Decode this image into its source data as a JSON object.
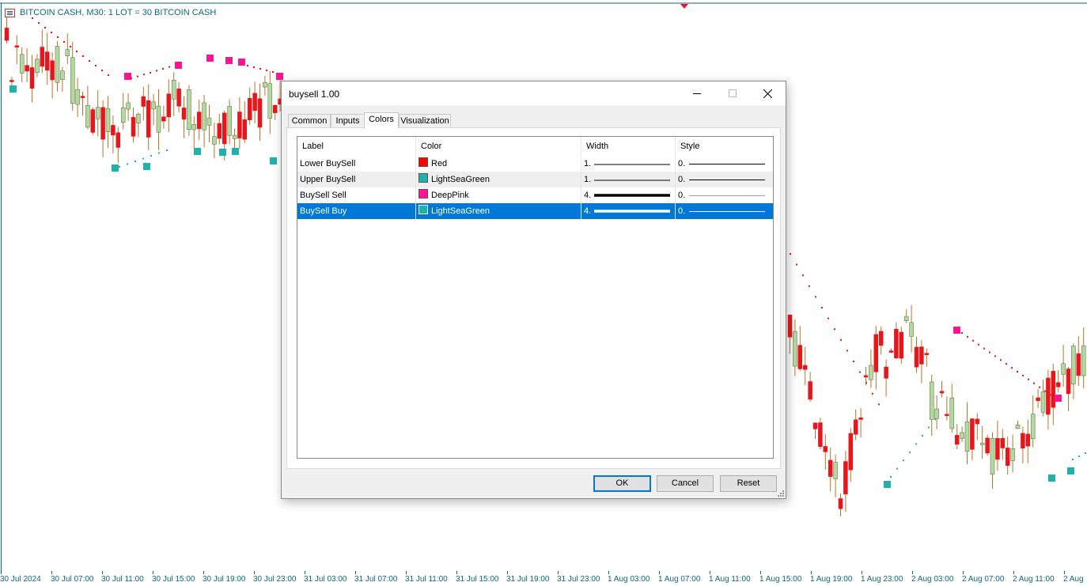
{
  "chart": {
    "header_text": "BITCOIN CASH, M30:  1 LOT = 30 BITCOIN CASH",
    "time_labels": [
      "30 Jul 2024",
      "30 Jul 07:00",
      "30 Jul 11:00",
      "30 Jul 15:00",
      "30 Jul 19:00",
      "30 Jul 23:00",
      "31 Jul 03:00",
      "31 Jul 07:00",
      "31 Jul 11:00",
      "31 Jul 15:00",
      "31 Jul 19:00",
      "31 Jul 23:00",
      "1 Aug 03:00",
      "1 Aug 07:00",
      "1 Aug 11:00",
      "1 Aug 15:00",
      "1 Aug 19:00",
      "1 Aug 23:00",
      "2 Aug 03:00",
      "2 Aug 07:00",
      "2 Aug 11:00",
      "2 Aug"
    ],
    "colors": {
      "bull": "#b7d7a0",
      "bear": "#e8161b",
      "wick": "#c0702a",
      "sell": "#ff1493",
      "buy": "#20b2aa",
      "axis": "#0b6a7a"
    }
  },
  "dialog": {
    "title": "buysell 1.00",
    "tabs": [
      {
        "label": "Common",
        "active": false
      },
      {
        "label": "Inputs",
        "active": false
      },
      {
        "label": "Colors",
        "active": true
      },
      {
        "label": "Visualization",
        "active": false
      }
    ],
    "columns": {
      "label": "Label",
      "color": "Color",
      "width": "Width",
      "style": "Style"
    },
    "rows": [
      {
        "label": "Lower BuySell",
        "color_name": "Red",
        "color_hex": "#ff0000",
        "width": "1.",
        "style": "0.",
        "line_weight": 1
      },
      {
        "label": "Upper BuySell",
        "color_name": "LightSeaGreen",
        "color_hex": "#20b2aa",
        "width": "1.",
        "style": "0.",
        "line_weight": 1
      },
      {
        "label": "BuySell Sell",
        "color_name": "DeepPink",
        "color_hex": "#ff1493",
        "width": "4.",
        "style": "0.",
        "line_weight": 4
      },
      {
        "label": "BuySell Buy",
        "color_name": "LightSeaGreen",
        "color_hex": "#20b2aa",
        "width": "4.",
        "style": "0.",
        "line_weight": 4,
        "selected": true
      }
    ],
    "buttons": {
      "ok": "OK",
      "cancel": "Cancel",
      "reset": "Reset"
    }
  }
}
